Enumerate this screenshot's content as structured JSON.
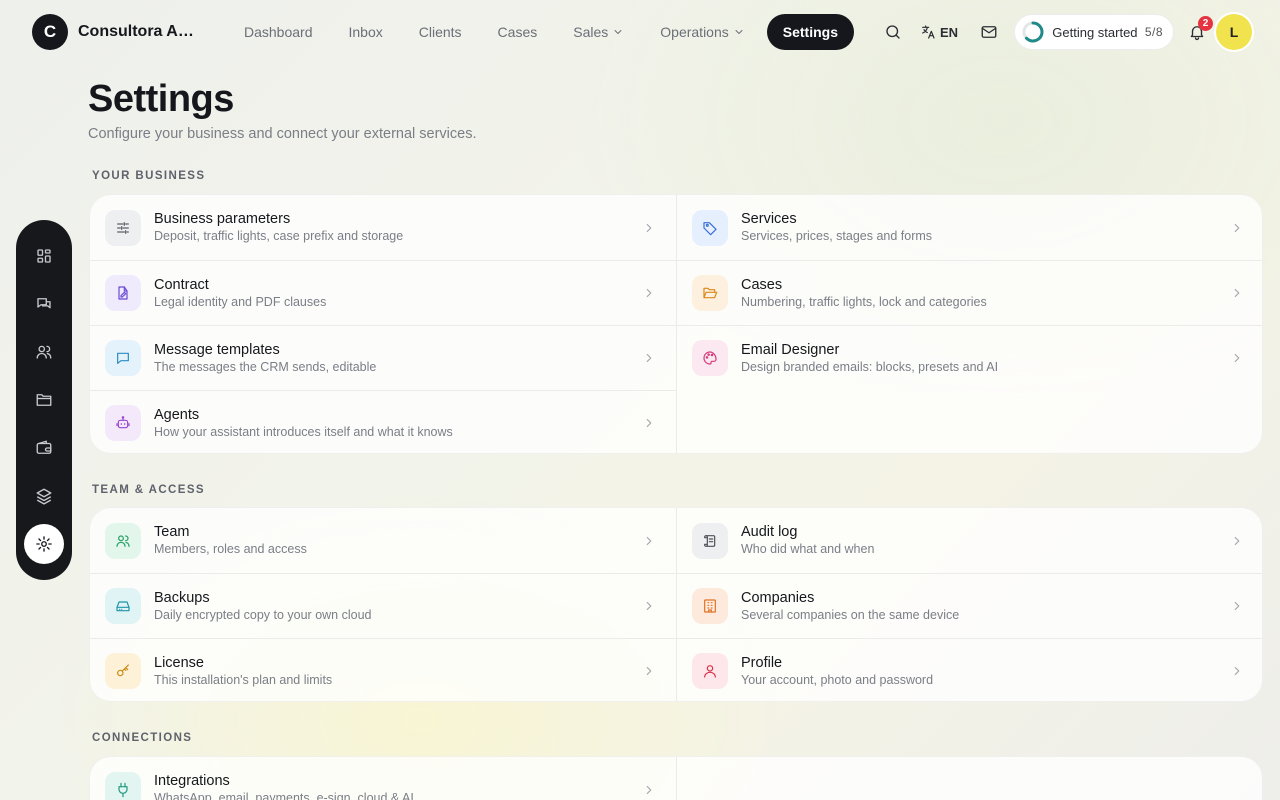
{
  "brand": {
    "initial": "C",
    "name": "Consultora Aur..."
  },
  "nav": {
    "links": [
      {
        "label": "Dashboard"
      },
      {
        "label": "Inbox"
      },
      {
        "label": "Clients"
      },
      {
        "label": "Cases"
      },
      {
        "label": "Sales"
      },
      {
        "label": "Operations"
      },
      {
        "label": "Settings"
      }
    ],
    "lang": "EN",
    "getting_started": {
      "label": "Getting started",
      "count": "5/8",
      "progress": 0.625,
      "ring_color": "#1f8a8a"
    },
    "notifications": "2",
    "avatar": "L"
  },
  "page": {
    "title": "Settings",
    "subtitle": "Configure your business and connect your external services."
  },
  "sections": {
    "business": {
      "label": "YOUR BUSINESS",
      "left": [
        {
          "title": "Business parameters",
          "desc": "Deposit, traffic lights, case prefix and storage",
          "icon": "sliders-icon",
          "bg": "#eeeff0",
          "fg": "#5b5f66"
        },
        {
          "title": "Contract",
          "desc": "Legal identity and PDF clauses",
          "icon": "file-edit-icon",
          "bg": "#efeafc",
          "fg": "#6a4bd6"
        },
        {
          "title": "Message templates",
          "desc": "The messages the CRM sends, editable",
          "icon": "message-square-icon",
          "bg": "#e4f3fb",
          "fg": "#2a8cc4"
        },
        {
          "title": "Agents",
          "desc": "How your assistant introduces itself and what it knows",
          "icon": "bot-icon",
          "bg": "#f3e9fb",
          "fg": "#9a47d1"
        }
      ],
      "right": [
        {
          "title": "Services",
          "desc": "Services, prices, stages and forms",
          "icon": "tag-icon",
          "bg": "#e6effd",
          "fg": "#3a6fd8"
        },
        {
          "title": "Cases",
          "desc": "Numbering, traffic lights, lock and categories",
          "icon": "folder-open-icon",
          "bg": "#fdf0de",
          "fg": "#d98a1c"
        },
        {
          "title": "Email Designer",
          "desc": "Design branded emails: blocks, presets and AI",
          "icon": "palette-icon",
          "bg": "#fce8f1",
          "fg": "#d2397a"
        }
      ]
    },
    "team": {
      "label": "TEAM & ACCESS",
      "left": [
        {
          "title": "Team",
          "desc": "Members, roles and access",
          "icon": "users-icon",
          "bg": "#e3f6ec",
          "fg": "#23a065"
        },
        {
          "title": "Backups",
          "desc": "Daily encrypted copy to your own cloud",
          "icon": "hard-drive-icon",
          "bg": "#e0f4f6",
          "fg": "#1f95a8"
        },
        {
          "title": "License",
          "desc": "This installation's plan and limits",
          "icon": "key-icon",
          "bg": "#fdf1d8",
          "fg": "#c98a10"
        }
      ],
      "right": [
        {
          "title": "Audit log",
          "desc": "Who did what and when",
          "icon": "scroll-icon",
          "bg": "#eeeff0",
          "fg": "#4d5159"
        },
        {
          "title": "Companies",
          "desc": "Several companies on the same device",
          "icon": "building-icon",
          "bg": "#fdeadd",
          "fg": "#e07226"
        },
        {
          "title": "Profile",
          "desc": "Your account, photo and password",
          "icon": "user-icon",
          "bg": "#fde7ea",
          "fg": "#d8344d"
        }
      ]
    },
    "connections": {
      "label": "CONNECTIONS",
      "left": [
        {
          "title": "Integrations",
          "desc": "WhatsApp, email, payments, e-sign, cloud & AI",
          "icon": "plug-icon",
          "bg": "#e2f5f0",
          "fg": "#1f9a80"
        }
      ]
    }
  },
  "dock": {
    "items": [
      "dashboard-icon",
      "messages-icon",
      "users-icon",
      "folder-icon",
      "wallet-icon",
      "layers-icon",
      "settings-icon"
    ]
  }
}
